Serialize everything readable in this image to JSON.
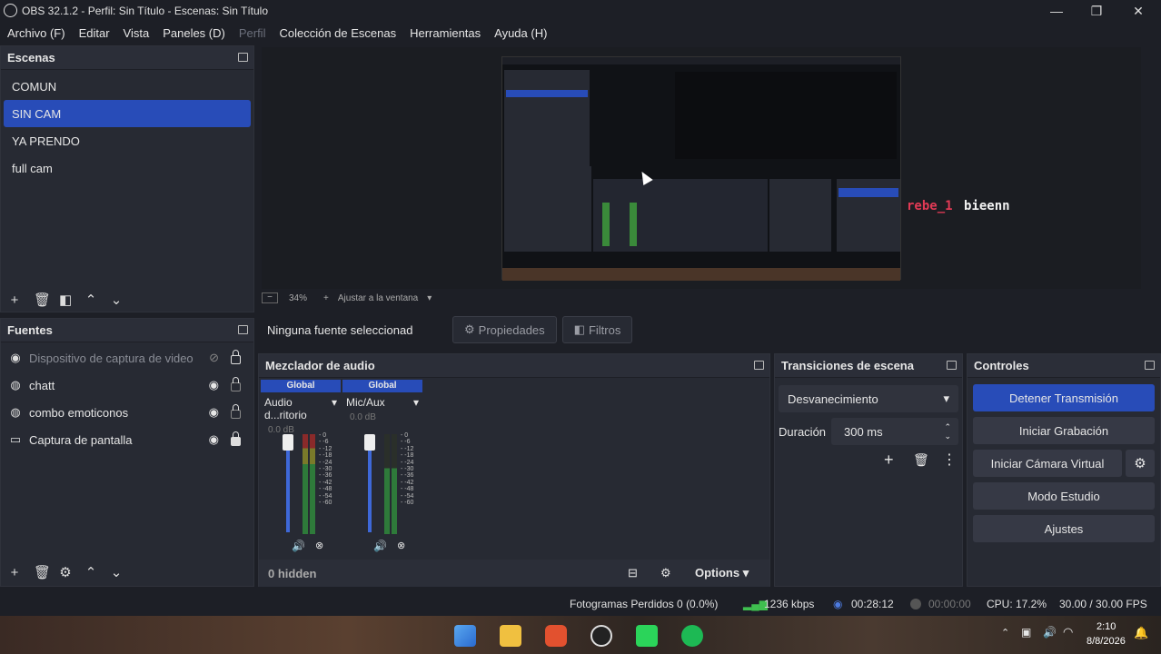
{
  "window": {
    "title": "OBS 32.1.2 - Perfil: Sin Título - Escenas: Sin Título",
    "controls": [
      "—",
      "❐",
      "✕"
    ]
  },
  "menu": [
    "Archivo (F)",
    "Editar",
    "Vista",
    "Paneles (D)",
    "Perfil",
    "Colección de Escenas",
    "Herramientas",
    "Ayuda (H)"
  ],
  "scenes": {
    "title": "Escenas",
    "items": [
      "COMUN",
      "SIN CAM",
      "YA PRENDO",
      "full cam"
    ],
    "selected": "SIN CAM"
  },
  "sources": {
    "title": "Fuentes",
    "items": [
      {
        "label": "Dispositivo de captura de video",
        "icon": "camera-icon"
      },
      {
        "label": "chatt",
        "icon": "globe-icon"
      },
      {
        "label": "combo emoticonos",
        "icon": "globe-icon"
      },
      {
        "label": "Captura de pantalla",
        "icon": "monitor-icon"
      }
    ]
  },
  "preview": {
    "chat_user": "rebe_1",
    "chat_message": "bieenn",
    "zoom": "34%",
    "fit_label": "Ajustar a la ventana"
  },
  "props_bar": {
    "no_source": "Ninguna fuente seleccionad",
    "properties": "Propiedades",
    "filters": "Filtros"
  },
  "mixer": {
    "title": "Mezclador de audio",
    "channels": [
      {
        "tag": "Global",
        "name": "Audio d...ritorio",
        "db": "0.0 dB",
        "level": 0.85
      },
      {
        "tag": "Global",
        "name": "Mic/Aux",
        "db": "0.0 dB",
        "level": 0.85
      }
    ],
    "scale": [
      "0",
      "-6",
      "-12",
      "-18",
      "-24",
      "-30",
      "-36",
      "-42",
      "-48",
      "-54",
      "-60"
    ],
    "hidden": "0 hidden",
    "options": "Options"
  },
  "transitions": {
    "title": "Transiciones de escena",
    "selected": "Desvanecimiento",
    "duration_label": "Duración",
    "duration_value": "300 ms"
  },
  "controls": {
    "title": "Controles",
    "stop_stream": "Detener Transmisión",
    "start_recording": "Iniciar Grabación",
    "start_virtual_cam": "Iniciar Cámara Virtual",
    "studio_mode": "Modo Estudio",
    "settings": "Ajustes"
  },
  "status": {
    "dropped_frames": "Fotogramas Perdidos 0 (0.0%)",
    "bitrate": "1236 kbps",
    "stream_time": "00:28:12",
    "rec_time": "00:00:00",
    "cpu": "CPU: 17.2%",
    "fps": "30.00 / 30.00 FPS"
  },
  "taskbar": {
    "time": "2:10",
    "date": "8/8/2026"
  }
}
